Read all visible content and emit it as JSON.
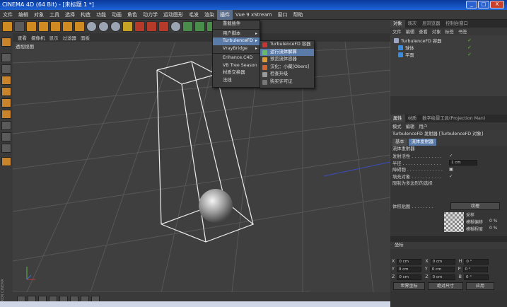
{
  "window": {
    "title": "CINEMA 4D (64 Bit) - [未标题 1 *]",
    "btn_min": "_",
    "btn_max": "□",
    "btn_close": "X"
  },
  "menubar": [
    "文件",
    "编辑",
    "对象",
    "工具",
    "选择",
    "构造",
    "功能",
    "动画",
    "角色",
    "动力学",
    "运动图形",
    "毛发",
    "渲染",
    "插件",
    "Vue 9 xStream",
    "窗口",
    "帮助"
  ],
  "active_menu": "插件",
  "viewport": {
    "menus": [
      "查看",
      "摄像机",
      "显示",
      "过滤器",
      "面板"
    ],
    "label": "透视视图"
  },
  "plugins_menu": [
    {
      "label": "重载插件",
      "arrow": ""
    },
    {
      "label": "用户脚本",
      "arrow": "▸"
    },
    {
      "label": "TurbulenceFD",
      "arrow": "▸"
    },
    {
      "label": "VrayBridge",
      "arrow": "▸"
    },
    {
      "label": "Enhance.C4D",
      "arrow": ""
    },
    {
      "label": "VB Tree Season",
      "arrow": ""
    },
    {
      "label": "材质交换器",
      "arrow": ""
    },
    {
      "label": "法线",
      "arrow": ""
    }
  ],
  "turbulence_submenu": [
    {
      "label": "TurbulenceFD 容器"
    },
    {
      "label": "运行流体解算"
    },
    {
      "label": "预览流体容器"
    },
    {
      "label": "汉化：小藏[Obers]"
    },
    {
      "label": "检查升级"
    },
    {
      "label": "购买许可证"
    }
  ],
  "right_panel": {
    "top_tabs": [
      "对象",
      "场次",
      "层浏览器",
      "控制台窗口"
    ],
    "top_sub": [
      "文件",
      "编辑",
      "查看",
      "对象",
      "标签",
      "书签"
    ],
    "objects": [
      {
        "name": "TurbulenceFD 容器",
        "color": "#9aa7c7"
      },
      {
        "name": "球体",
        "color": "#3a8ce0"
      },
      {
        "name": "平面",
        "color": "#3a8ce0"
      }
    ],
    "attr_tabs": [
      "属性",
      "材质",
      "数字绘景工具(Projection Man)"
    ],
    "attr_sub": [
      "模式",
      "编辑",
      "用户"
    ],
    "object_title": "TurbulenceFD 发射器 [TurbulenceFD 对象]",
    "attr_subtabs": [
      "基本",
      "流体发射器"
    ],
    "section": "流体发射器",
    "fields": [
      {
        "label": "发射活性 . . . . . . . . . . .",
        "value": "✓"
      },
      {
        "label": "半径 . . . . . . . . . . . . . .",
        "value": "1 cm"
      },
      {
        "label": "障碍物 . . . . . . . . . . . . .",
        "value": "▣"
      },
      {
        "label": "填充对象 . . . . . . . . . . .",
        "value": "✓"
      },
      {
        "label": "限制为多边形的选择",
        "value": ""
      }
    ],
    "texture_label": "体积贴图 . . . . . . . .",
    "texture_button": "纹理",
    "sample_label": "采样",
    "tex_scale_label": "模糊偏移",
    "tex_scale_value": "0 %",
    "tex_offset_label": "模糊程度",
    "tex_offset_value": "0 %",
    "coords_title": "坐标",
    "coords": [
      {
        "axis": "X",
        "val": "0 cm",
        "axis2": "X",
        "val2": "0 cm",
        "axis3": "H",
        "val3": "0 °"
      },
      {
        "axis": "Y",
        "val": "0 cm",
        "axis2": "Y",
        "val2": "0 cm",
        "axis3": "P",
        "val3": "0 °"
      },
      {
        "axis": "Z",
        "val": "0 cm",
        "axis2": "Z",
        "val2": "0 cm",
        "axis3": "B",
        "val3": "0 °"
      }
    ],
    "world_select": "世界坐标",
    "scale_select": "绝对尺寸",
    "apply": "应用"
  },
  "logo_text": "MAXON CINEMA 4D"
}
